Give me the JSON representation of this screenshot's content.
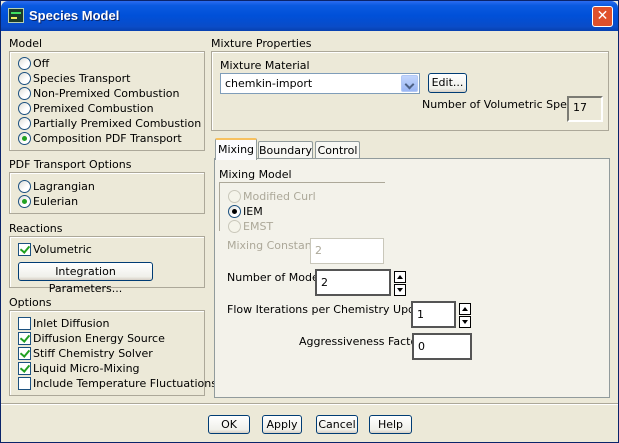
{
  "window": {
    "title": "Species Model",
    "close": "✕"
  },
  "model": {
    "label": "Model",
    "options": [
      "Off",
      "Species Transport",
      "Non-Premixed Combustion",
      "Premixed Combustion",
      "Partially Premixed Combustion",
      "Composition PDF Transport"
    ],
    "selected": "Composition PDF Transport"
  },
  "pdf": {
    "label": "PDF Transport Options",
    "options": [
      "Lagrangian",
      "Eulerian"
    ],
    "selected": "Eulerian"
  },
  "reactions": {
    "label": "Reactions",
    "volumetric": "Volumetric",
    "volumetric_checked": true,
    "integration_button": "Integration Parameters..."
  },
  "options": {
    "label": "Options",
    "items": [
      {
        "label": "Inlet Diffusion",
        "checked": false
      },
      {
        "label": "Diffusion Energy Source",
        "checked": true
      },
      {
        "label": "Stiff Chemistry Solver",
        "checked": true
      },
      {
        "label": "Liquid Micro-Mixing",
        "checked": true
      },
      {
        "label": "Include Temperature Fluctuations",
        "checked": false
      }
    ]
  },
  "mixture": {
    "label": "Mixture Properties",
    "material_label": "Mixture Material",
    "material_value": "chemkin-import",
    "edit_button": "Edit...",
    "num_species_label": "Number of Volumetric Species",
    "num_species_value": "17"
  },
  "tabs": [
    "Mixing",
    "Boundary",
    "Control"
  ],
  "active_tab": "Mixing",
  "mixing": {
    "model_label": "Mixing Model",
    "models": [
      "Modified Curl",
      "IEM",
      "EMST"
    ],
    "selected": "IEM",
    "constant_label": "Mixing Constant",
    "constant_value": "2",
    "modes_label": "Number of Modes",
    "modes_value": "2",
    "flow_label": "Flow Iterations per Chemistry Update",
    "flow_value": "1",
    "aggr_label": "Aggressiveness Factor",
    "aggr_value": "0"
  },
  "footer": {
    "ok": "OK",
    "apply": "Apply",
    "cancel": "Cancel",
    "help": "Help"
  },
  "colors": {
    "title_bar": "#0050d8",
    "dialog_bg": "#ece9d8",
    "radio_dot": "#21a121",
    "tab_highlight": "#f7c15f"
  }
}
